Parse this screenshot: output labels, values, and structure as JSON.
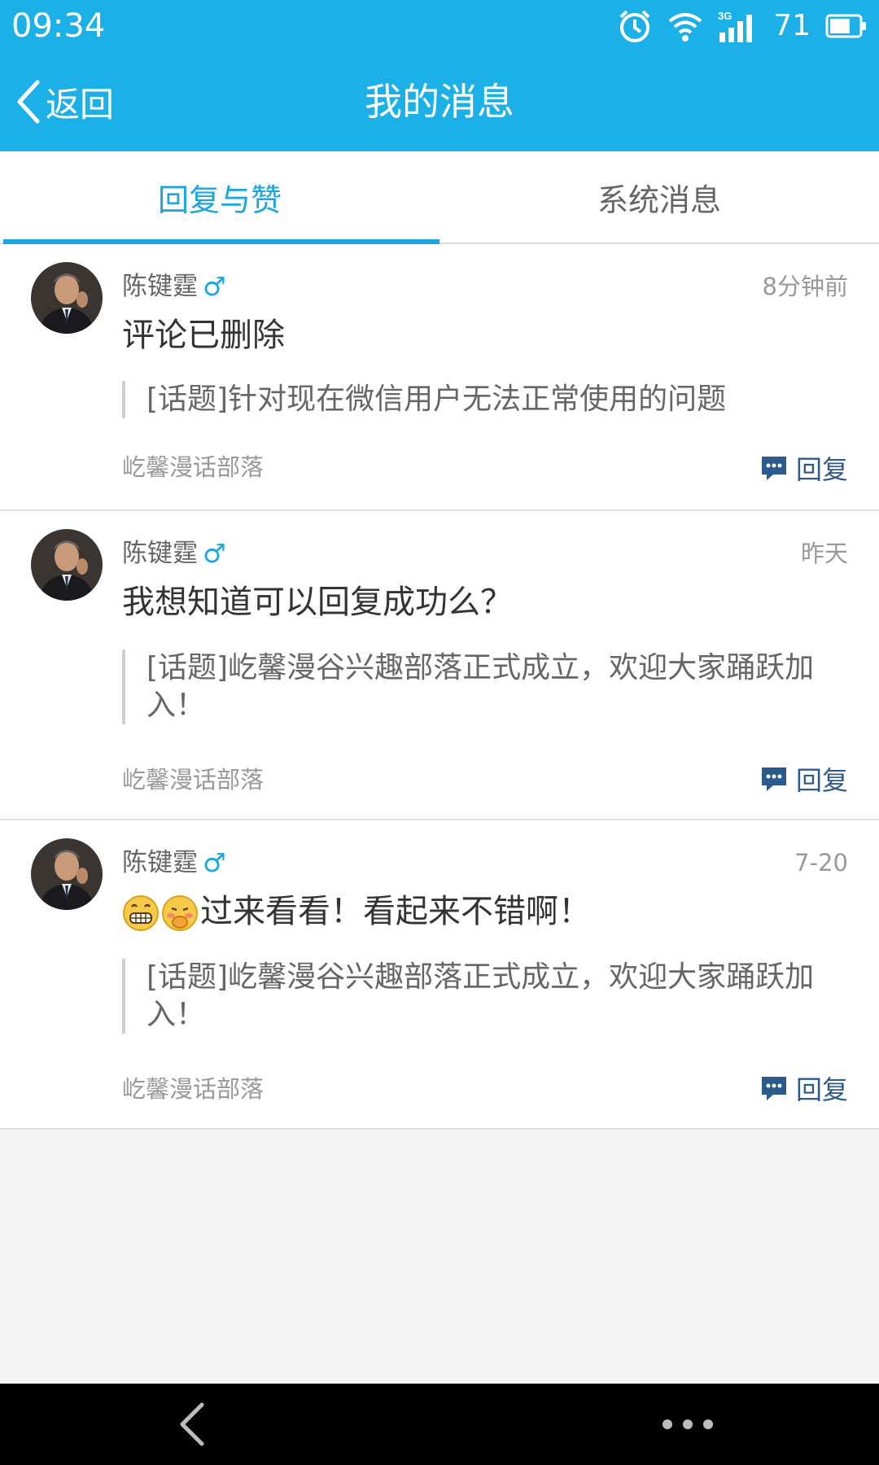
{
  "status_bar": {
    "time": "09:34",
    "network": "3G",
    "battery": "71",
    "icons": [
      "alarm-icon",
      "wifi-icon",
      "signal-icon",
      "battery-icon"
    ]
  },
  "header": {
    "back_label": "返回",
    "title": "我的消息"
  },
  "tabs": [
    {
      "label": "回复与赞",
      "active": true
    },
    {
      "label": "系统消息",
      "active": false
    }
  ],
  "messages": [
    {
      "user": "陈键霆",
      "gender": "♂",
      "time": "8分钟前",
      "content": "评论已删除",
      "quote": "[话题]针对现在微信用户无法正常使用的问题",
      "source": "屹馨漫话部落",
      "reply_label": "回复"
    },
    {
      "user": "陈键霆",
      "gender": "♂",
      "time": "昨天",
      "content": "我想知道可以回复成功么？",
      "quote": "[话题]屹馨漫谷兴趣部落正式成立，欢迎大家踊跃加入！",
      "source": "屹馨漫话部落",
      "reply_label": "回复"
    },
    {
      "user": "陈键霆",
      "gender": "♂",
      "time": "7-20",
      "content": "过来看看！看起来不错啊！",
      "quote": "[话题]屹馨漫谷兴趣部落正式成立，欢迎大家踊跃加入！",
      "source": "屹馨漫话部落",
      "reply_label": "回复"
    }
  ],
  "colors": {
    "header_bg": "#1bb0e8",
    "accent": "#1ba6e0",
    "reply": "#2d5a8c"
  }
}
